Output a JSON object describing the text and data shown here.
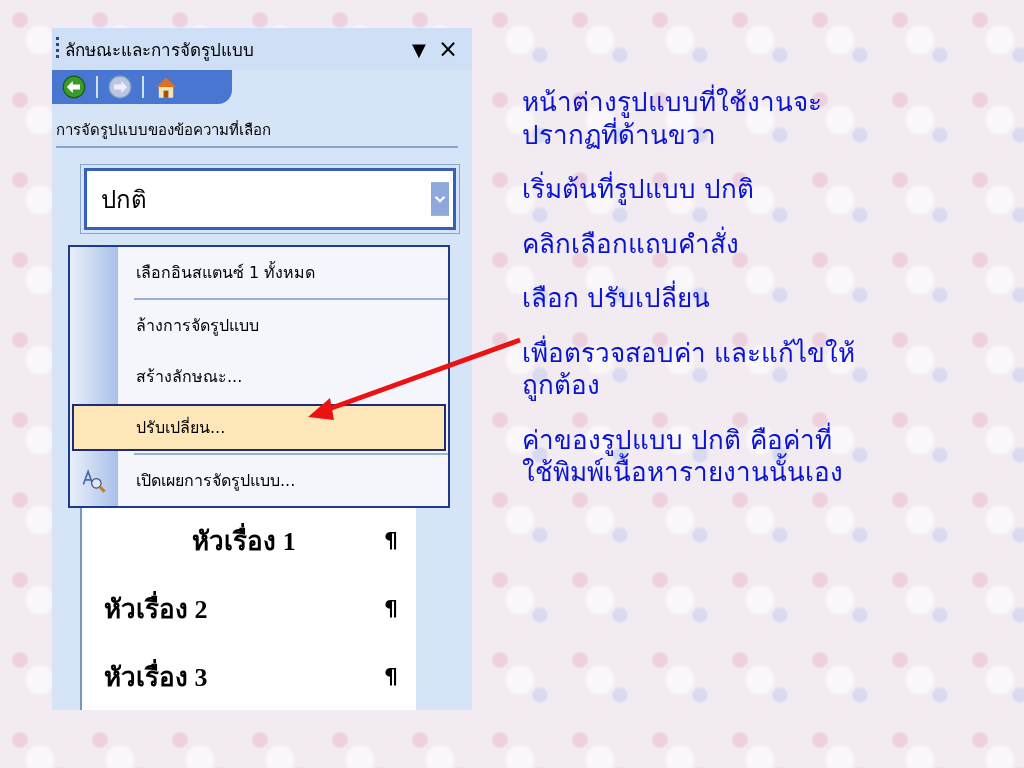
{
  "task_pane": {
    "title": "ลักษณะและการจัดรูปแบบ",
    "menu_glyph": "▼",
    "close_glyph": "×",
    "section_title": "การจัดรูปแบบของข้อความที่เลือก",
    "style_box": {
      "value": "ปกติ"
    },
    "menu": [
      {
        "kind": "item",
        "label": "เลือกอินสแตนซ์ 1 ทั้งหมด",
        "selected": false
      },
      {
        "kind": "separator"
      },
      {
        "kind": "item",
        "label": "ล้างการจัดรูปแบบ",
        "selected": false
      },
      {
        "kind": "item",
        "label": "สร้างลักษณะ...",
        "selected": false
      },
      {
        "kind": "item",
        "label": "ปรับเปลี่ยน...",
        "selected": true
      },
      {
        "kind": "separator"
      },
      {
        "kind": "icon-item",
        "label": "เปิดเผยการจัดรูปแบบ...",
        "selected": false
      }
    ],
    "styles": [
      {
        "label": "หัวเรื่อง 1",
        "mark": "¶",
        "centered": true
      },
      {
        "label": "หัวเรื่อง 2",
        "mark": "¶",
        "centered": false
      },
      {
        "label": "หัวเรื่อง 3",
        "mark": "¶",
        "centered": false
      }
    ]
  },
  "notes": [
    {
      "lines": [
        "หน้าต่างรูปแบบที่ใช้งานจะ",
        "ปรากฏที่ด้านขวา"
      ]
    },
    {
      "lines": [
        "เริ่มต้นที่รูปแบบ ปกติ"
      ]
    },
    {
      "lines": [
        "คลิกเลือกแถบคำสั่ง"
      ]
    },
    {
      "lines": [
        "เลือก ปรับเปลี่ยน"
      ]
    },
    {
      "lines": [
        "เพื่อตรวจสอบค่า และแก้ไขให้",
        "ถูกต้อง"
      ]
    },
    {
      "lines": [
        "ค่าของรูปแบบ ปกติ คือค่าที่",
        "ใช้พิมพ์เนื้อหารายงานนั้นเอง"
      ]
    }
  ]
}
